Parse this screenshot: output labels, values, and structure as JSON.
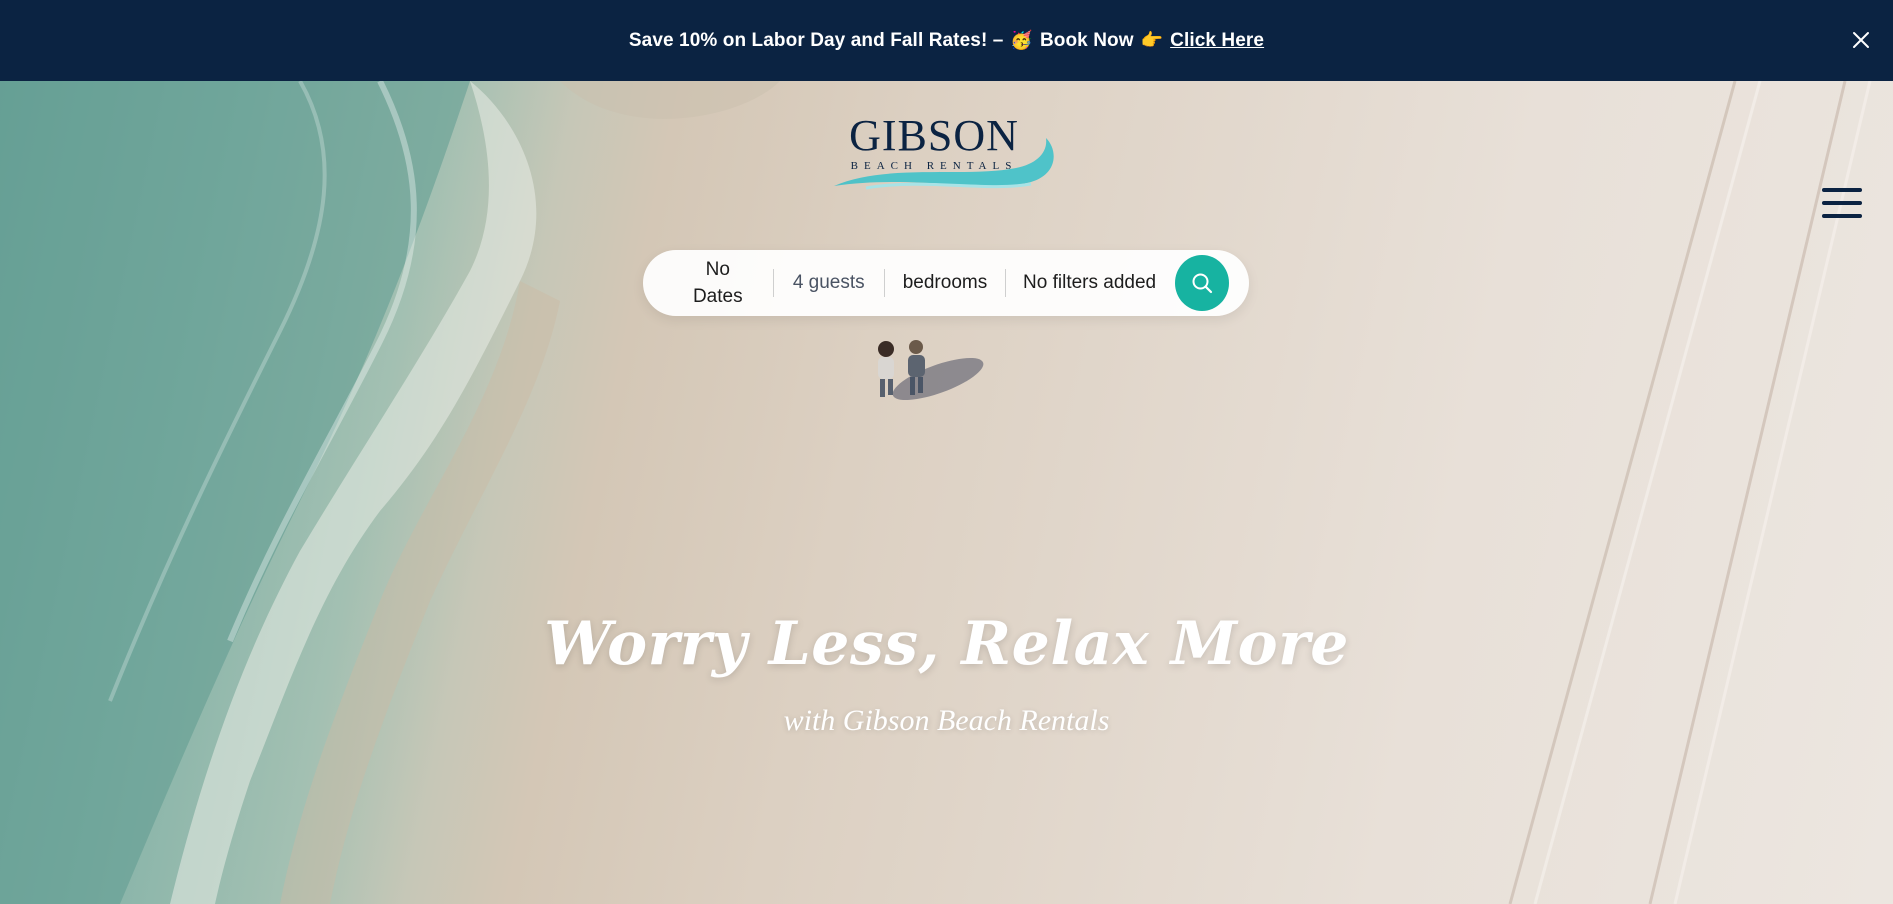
{
  "promo": {
    "text": "Save 10% on Labor Day and Fall Rates! –",
    "emoji_1": "🥳",
    "book_now": "Book Now",
    "emoji_2": "👉",
    "link_label": "Click Here"
  },
  "brand": {
    "name": "GIBSON",
    "tagline": "BEACH RENTALS",
    "navy": "#0b2342",
    "teal": "#17b3a1"
  },
  "search": {
    "dates_line1": "No",
    "dates_line2": "Dates",
    "guests": "4 guests",
    "bedrooms": "bedrooms",
    "filters": "No filters added"
  },
  "hero": {
    "headline": "Worry Less, Relax More",
    "subline": "with Gibson Beach Rentals"
  },
  "icons": {
    "close": "close-icon",
    "menu": "hamburger-menu-icon",
    "search": "search-icon"
  }
}
